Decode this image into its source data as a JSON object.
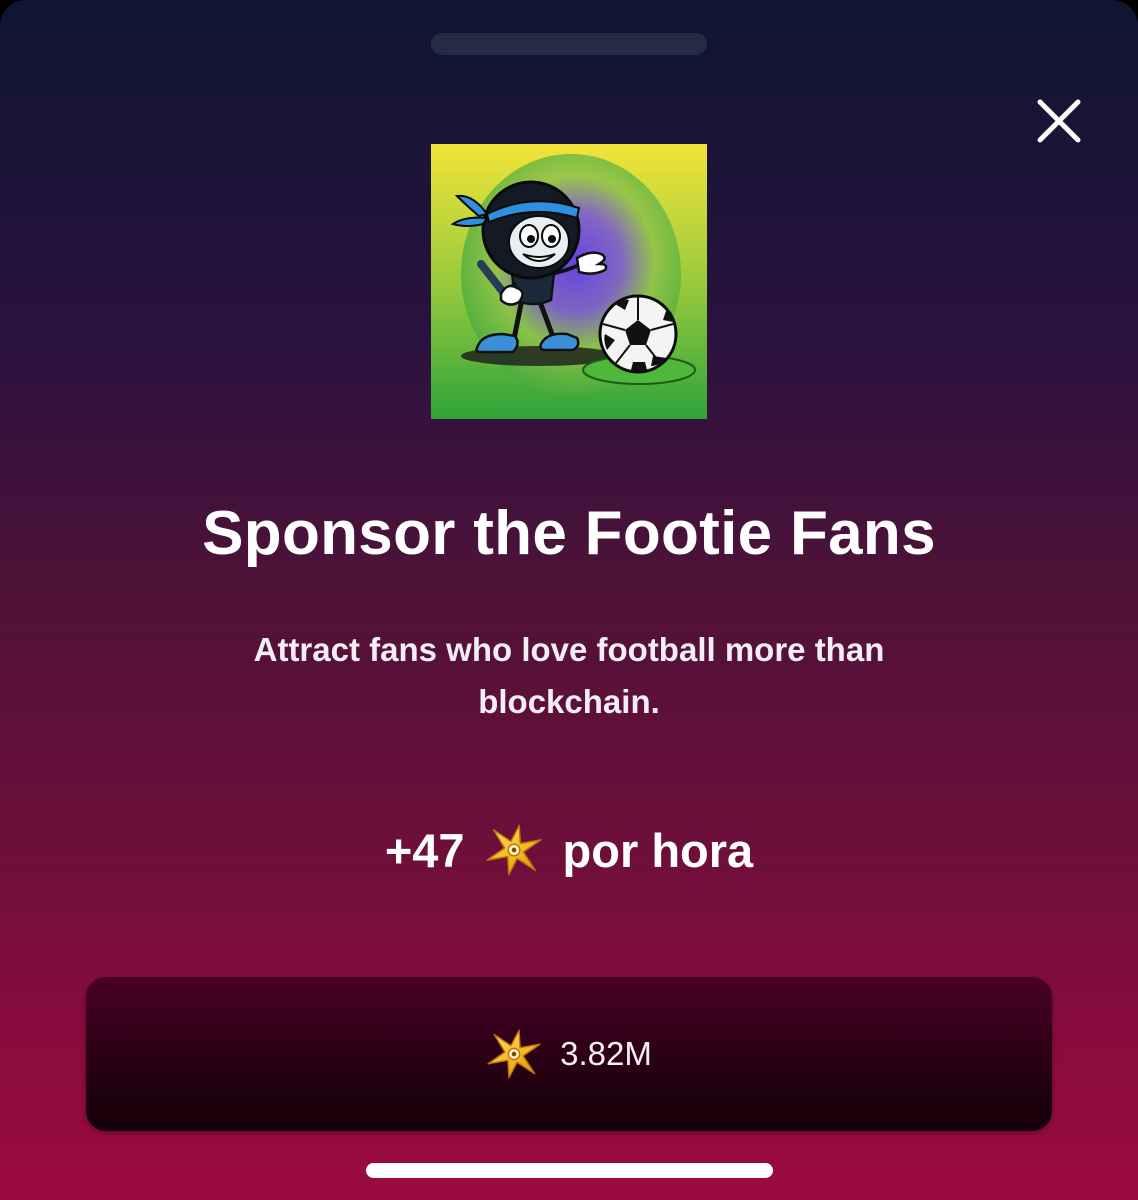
{
  "card": {
    "title": "Sponsor the Footie Fans",
    "description": "Attract fans who love football more than blockchain.",
    "profit": {
      "amount": "+47",
      "unit": "por hora",
      "currency_icon": "shuriken-coin-icon"
    }
  },
  "purchase_button": {
    "price": "3.82M",
    "currency_icon": "shuriken-coin-icon"
  },
  "icons": {
    "close": "close-icon"
  },
  "colors": {
    "background_top": "#0f1532",
    "background_bottom": "#9b0a40",
    "button_background": "#2a0014",
    "coin": "#f5c02a"
  }
}
